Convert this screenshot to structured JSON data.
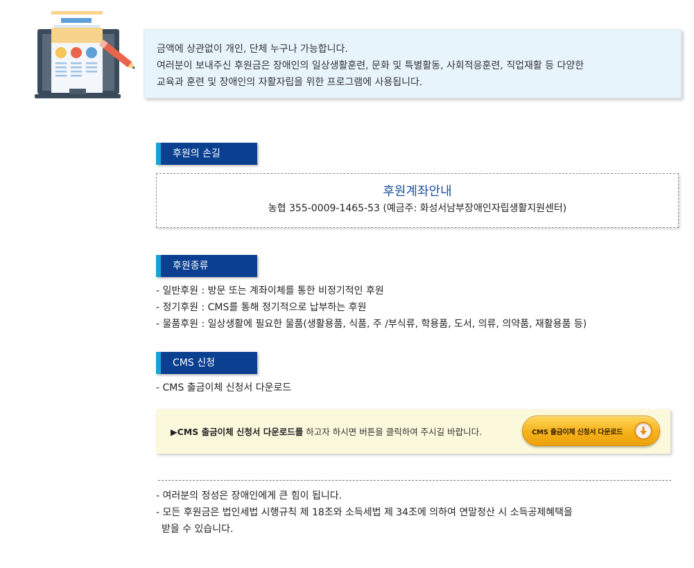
{
  "intro": {
    "lines": [
      "금액에 상관없이 개인, 단체 누구나 가능합니다.",
      "여러분이 보내주신 후원금은 장애인의 일상생활훈련, 문화 및 특별활동, 사회적응훈련, 직업재활 등 다양한",
      "교육과 훈련 및 장애인의 자활자립을 위한 프로그램에 사용됩니다."
    ]
  },
  "sections": {
    "hands": {
      "title": "후원의 손길"
    },
    "types": {
      "title": "후원종류"
    },
    "cms": {
      "title": "CMS 신청"
    }
  },
  "account": {
    "title": "후원계좌안내",
    "info": "농협 355-0009-1465-53  (예금주: 화성서남부장애인자립생활지원센터)"
  },
  "types_list": [
    "- 일반후원 : 방문 또는 계좌이체를 통한 비정기적인 후원",
    "- 정기후원 : CMS를 통해 정기적으로 납부하는 후원",
    "- 물품후원 : 일상생활에 필요한 물품(생활용품, 식품, 주 /부식류, 학용품, 도서, 의류, 의약품, 재활용품 등)"
  ],
  "cms_list": [
    "- CMS 출금이체 신청서 다운로드"
  ],
  "cms_box": {
    "bold_text": "▶CMS 출금이체 신청서 다운로드를",
    "text": " 하고자 하시면 버튼을 클릭하여 주시길 바랍니다.",
    "button_label": "CMS 출금이체 신청서 다운로드",
    "button_icon": "download-arrow-icon"
  },
  "notes": [
    "- 여러분의 정성은 장애인에게 큰 힘이 됩니다.",
    "- 모든 후원금은 법인세법 시행규칙 제 18조와 소득세법 제 34조에 의하여 연말정산 시 소득공제혜택을",
    "  받을 수 있습니다."
  ],
  "colors": {
    "header_bg": "#0b3f8f",
    "header_accent": "#1ba1d9",
    "intro_bg": "#e8f4fc",
    "account_title": "#1c4f9c",
    "cms_box_bg": "#fbf8dc",
    "button": "#f6b21a"
  }
}
